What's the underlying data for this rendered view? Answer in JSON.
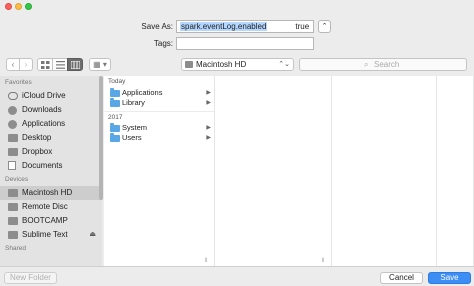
{
  "save_form": {
    "save_as_label": "Save As:",
    "filename_selected": "spark.eventLog.enabled",
    "filename_rest": "true",
    "tags_label": "Tags:",
    "tags_value": ""
  },
  "toolbar": {
    "back": "‹",
    "forward": "›",
    "location": "Macintosh HD",
    "search_placeholder": "Search"
  },
  "sidebar": {
    "favorites_header": "Favorites",
    "favorites": [
      {
        "label": "iCloud Drive",
        "icon": "cloud-icon"
      },
      {
        "label": "Downloads",
        "icon": "downloads-icon"
      },
      {
        "label": "Applications",
        "icon": "applications-icon"
      },
      {
        "label": "Desktop",
        "icon": "desktop-icon"
      },
      {
        "label": "Dropbox",
        "icon": "dropbox-icon"
      },
      {
        "label": "Documents",
        "icon": "documents-icon"
      }
    ],
    "devices_header": "Devices",
    "devices": [
      {
        "label": "Macintosh HD",
        "icon": "disk-icon",
        "selected": true
      },
      {
        "label": "Remote Disc",
        "icon": "remote-disc-icon"
      },
      {
        "label": "BOOTCAMP",
        "icon": "disk-icon"
      },
      {
        "label": "Sublime Text",
        "icon": "disk-icon",
        "eject": "⏏"
      }
    ],
    "shared_header": "Shared"
  },
  "browser": {
    "today_header": "Today",
    "today_items": [
      "Applications",
      "Library"
    ],
    "year_header": "2017",
    "year_items": [
      "System",
      "Users"
    ]
  },
  "footer": {
    "new_folder": "New Folder",
    "cancel": "Cancel",
    "save": "Save"
  },
  "colors": {
    "accent": "#3c8df4",
    "folder": "#5aa7e6"
  }
}
